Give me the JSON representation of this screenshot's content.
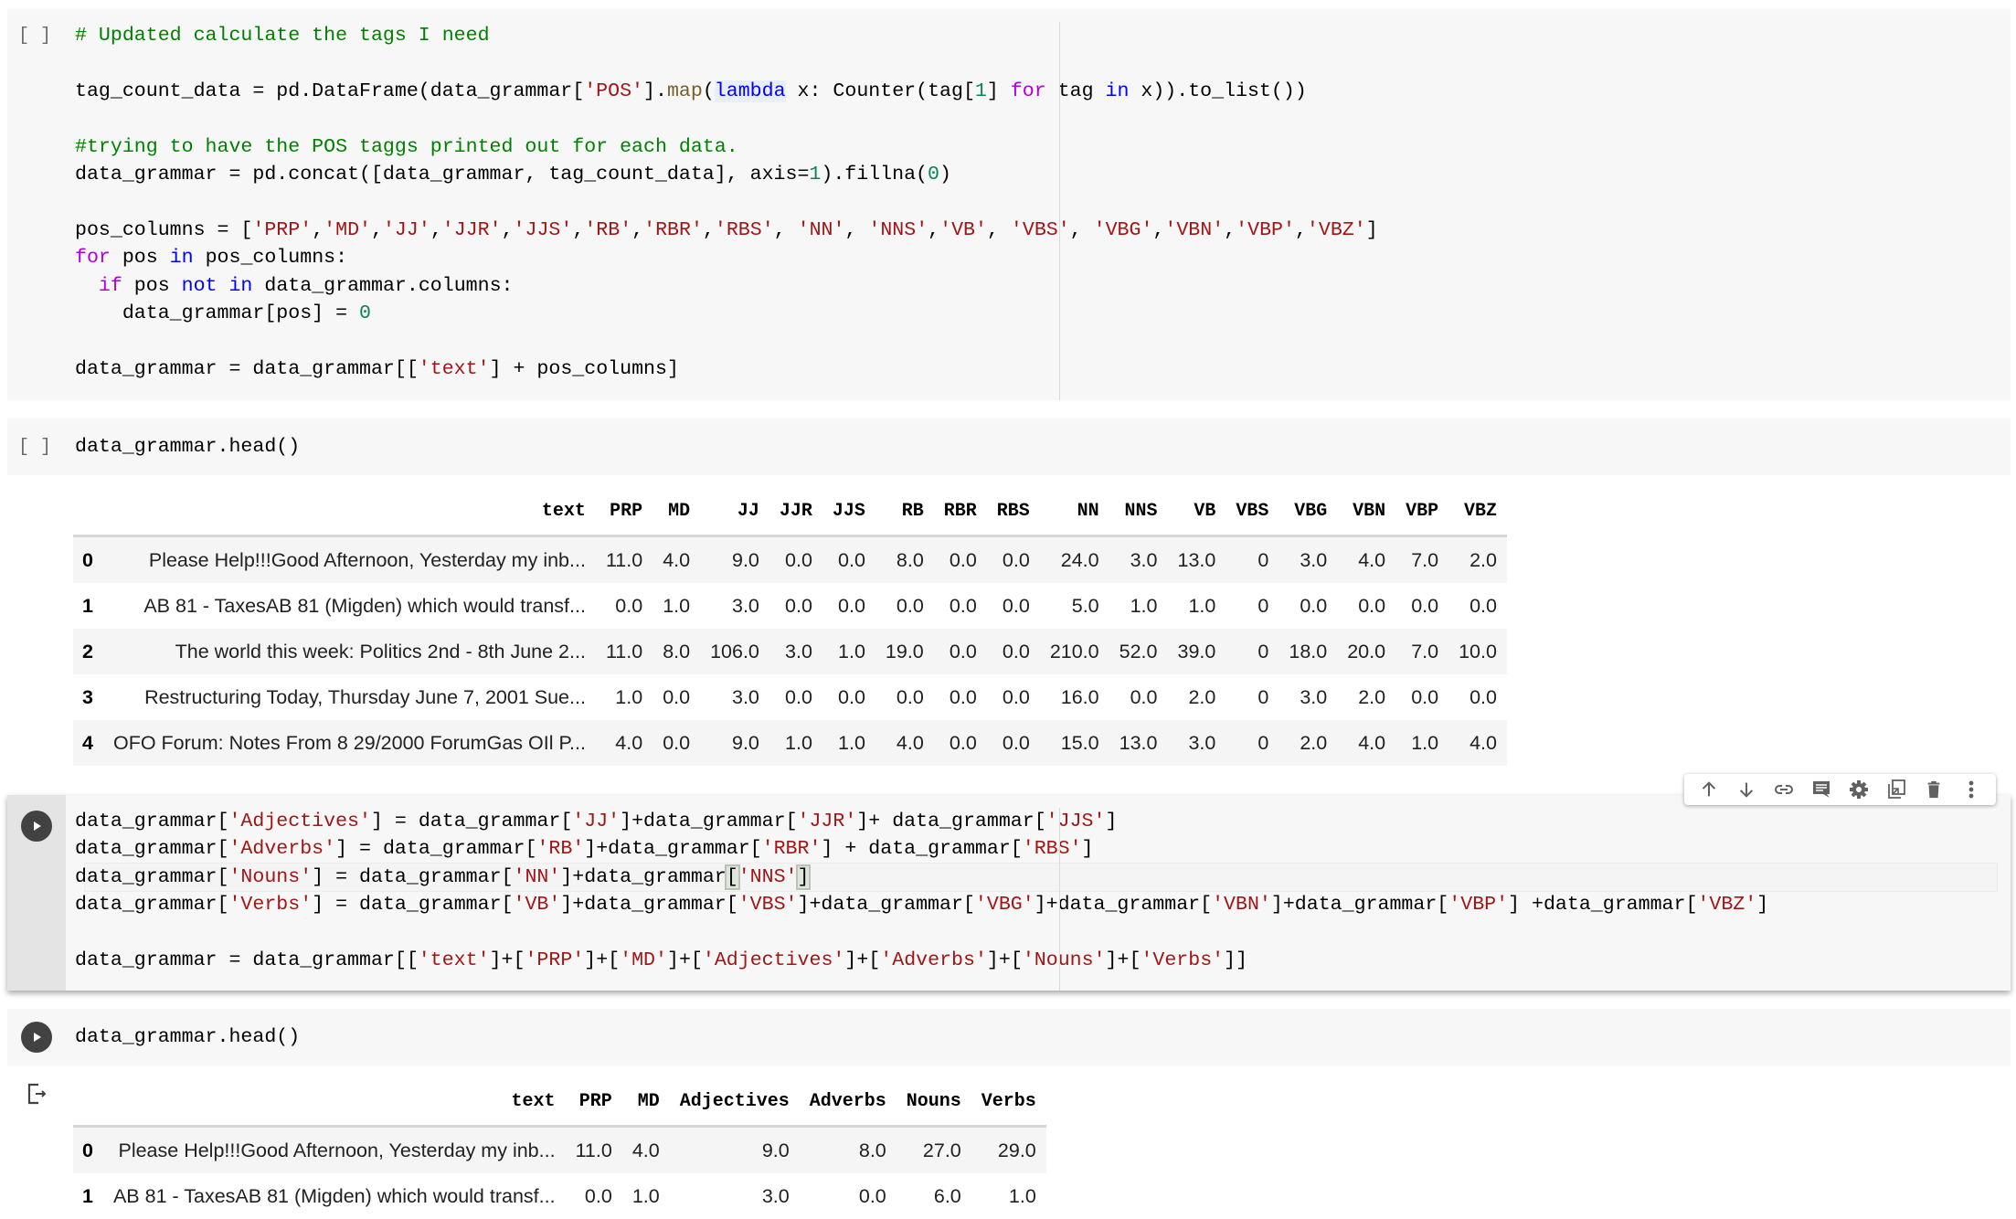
{
  "cells": [
    {
      "prompt": "[ ]",
      "lines": [
        [
          {
            "t": "# Updated calculate the tags I need",
            "c": "c-com"
          }
        ],
        [],
        [
          {
            "t": "tag_count_data = pd.DataFrame(data_grammar["
          },
          {
            "t": "'POS'",
            "c": "c-str"
          },
          {
            "t": "]."
          },
          {
            "t": "map",
            "c": "c-fn"
          },
          {
            "t": "("
          },
          {
            "t": "lambda",
            "c": "c-op hl-lambda"
          },
          {
            "t": " x: Counter(tag["
          },
          {
            "t": "1",
            "c": "c-num"
          },
          {
            "t": "] "
          },
          {
            "t": "for",
            "c": "c-kw"
          },
          {
            "t": " tag "
          },
          {
            "t": "in",
            "c": "c-op"
          },
          {
            "t": " x)).to_list())"
          }
        ],
        [],
        [
          {
            "t": "#trying to have the POS taggs printed out for each data.",
            "c": "c-com"
          }
        ],
        [
          {
            "t": "data_grammar = pd.concat([data_grammar, tag_count_data], axis="
          },
          {
            "t": "1",
            "c": "c-num"
          },
          {
            "t": ").fillna("
          },
          {
            "t": "0",
            "c": "c-num"
          },
          {
            "t": ")"
          }
        ],
        [],
        [
          {
            "t": "pos_columns = ["
          },
          {
            "t": "'PRP'",
            "c": "c-str"
          },
          {
            "t": ","
          },
          {
            "t": "'MD'",
            "c": "c-str"
          },
          {
            "t": ","
          },
          {
            "t": "'JJ'",
            "c": "c-str"
          },
          {
            "t": ","
          },
          {
            "t": "'JJR'",
            "c": "c-str"
          },
          {
            "t": ","
          },
          {
            "t": "'JJS'",
            "c": "c-str"
          },
          {
            "t": ","
          },
          {
            "t": "'RB'",
            "c": "c-str"
          },
          {
            "t": ","
          },
          {
            "t": "'RBR'",
            "c": "c-str"
          },
          {
            "t": ","
          },
          {
            "t": "'RBS'",
            "c": "c-str"
          },
          {
            "t": ", "
          },
          {
            "t": "'NN'",
            "c": "c-str"
          },
          {
            "t": ", "
          },
          {
            "t": "'NNS'",
            "c": "c-str"
          },
          {
            "t": ","
          },
          {
            "t": "'VB'",
            "c": "c-str"
          },
          {
            "t": ", "
          },
          {
            "t": "'VBS'",
            "c": "c-str"
          },
          {
            "t": ", "
          },
          {
            "t": "'VBG'",
            "c": "c-str"
          },
          {
            "t": ","
          },
          {
            "t": "'VBN'",
            "c": "c-str"
          },
          {
            "t": ","
          },
          {
            "t": "'VBP'",
            "c": "c-str"
          },
          {
            "t": ","
          },
          {
            "t": "'VBZ'",
            "c": "c-str"
          },
          {
            "t": "]"
          }
        ],
        [
          {
            "t": "for",
            "c": "c-kw"
          },
          {
            "t": " pos "
          },
          {
            "t": "in",
            "c": "c-op"
          },
          {
            "t": " pos_columns:"
          }
        ],
        [
          {
            "t": "  "
          },
          {
            "t": "if",
            "c": "c-kw"
          },
          {
            "t": " pos "
          },
          {
            "t": "not in",
            "c": "c-op"
          },
          {
            "t": " data_grammar.columns:"
          }
        ],
        [
          {
            "t": "    data_grammar[pos] = "
          },
          {
            "t": "0",
            "c": "c-num"
          }
        ],
        [],
        [
          {
            "t": "data_grammar = data_grammar[["
          },
          {
            "t": "'text'",
            "c": "c-str"
          },
          {
            "t": "] + pos_columns]"
          }
        ]
      ]
    },
    {
      "prompt": "[ ]",
      "lines": [
        [
          {
            "t": "data_grammar.head()"
          }
        ]
      ]
    },
    {
      "prompt": "",
      "lines": [
        [
          {
            "t": "data_grammar["
          },
          {
            "t": "'Adjectives'",
            "c": "c-str"
          },
          {
            "t": "] = data_grammar["
          },
          {
            "t": "'JJ'",
            "c": "c-str"
          },
          {
            "t": "]+data_grammar["
          },
          {
            "t": "'JJR'",
            "c": "c-str"
          },
          {
            "t": "]+ data_grammar["
          },
          {
            "t": "'JJS'",
            "c": "c-str"
          },
          {
            "t": "]"
          }
        ],
        [
          {
            "t": "data_grammar["
          },
          {
            "t": "'Adverbs'",
            "c": "c-str"
          },
          {
            "t": "] = data_grammar["
          },
          {
            "t": "'RB'",
            "c": "c-str"
          },
          {
            "t": "]+data_grammar["
          },
          {
            "t": "'RBR'",
            "c": "c-str"
          },
          {
            "t": "] + data_grammar["
          },
          {
            "t": "'RBS'",
            "c": "c-str"
          },
          {
            "t": "]"
          }
        ],
        [
          {
            "t": "data_grammar["
          },
          {
            "t": "'Nouns'",
            "c": "c-str"
          },
          {
            "t": "] = data_grammar["
          },
          {
            "t": "'NN'",
            "c": "c-str"
          },
          {
            "t": "]+data_grammar"
          },
          {
            "t": "[",
            "c": "hl-bracket"
          },
          {
            "t": "'NNS'",
            "c": "c-str"
          },
          {
            "t": "]",
            "c": "hl-bracket"
          }
        ],
        [
          {
            "t": "data_grammar["
          },
          {
            "t": "'Verbs'",
            "c": "c-str"
          },
          {
            "t": "] = data_grammar["
          },
          {
            "t": "'VB'",
            "c": "c-str"
          },
          {
            "t": "]+data_grammar["
          },
          {
            "t": "'VBS'",
            "c": "c-str"
          },
          {
            "t": "]+data_grammar["
          },
          {
            "t": "'VBG'",
            "c": "c-str"
          },
          {
            "t": "]+data_grammar["
          },
          {
            "t": "'VBN'",
            "c": "c-str"
          },
          {
            "t": "]+data_grammar["
          },
          {
            "t": "'VBP'",
            "c": "c-str"
          },
          {
            "t": "] +data_grammar["
          },
          {
            "t": "'VBZ'",
            "c": "c-str"
          },
          {
            "t": "]"
          }
        ],
        [],
        [
          {
            "t": "data_grammar = data_grammar[["
          },
          {
            "t": "'text'",
            "c": "c-str"
          },
          {
            "t": "]+["
          },
          {
            "t": "'PRP'",
            "c": "c-str"
          },
          {
            "t": "]+["
          },
          {
            "t": "'MD'",
            "c": "c-str"
          },
          {
            "t": "]+["
          },
          {
            "t": "'Adjectives'",
            "c": "c-str"
          },
          {
            "t": "]+["
          },
          {
            "t": "'Adverbs'",
            "c": "c-str"
          },
          {
            "t": "]+["
          },
          {
            "t": "'Nouns'",
            "c": "c-str"
          },
          {
            "t": "]+["
          },
          {
            "t": "'Verbs'",
            "c": "c-str"
          },
          {
            "t": "]]"
          }
        ]
      ]
    },
    {
      "prompt": "",
      "lines": [
        [
          {
            "t": "data_grammar.head()"
          }
        ]
      ]
    }
  ],
  "table1": {
    "columns": [
      "",
      "text",
      "PRP",
      "MD",
      "JJ",
      "JJR",
      "JJS",
      "RB",
      "RBR",
      "RBS",
      "NN",
      "NNS",
      "VB",
      "VBS",
      "VBG",
      "VBN",
      "VBP",
      "VBZ"
    ],
    "rows": [
      [
        "0",
        "Please Help!!!Good Afternoon, Yesterday my inb...",
        "11.0",
        "4.0",
        "9.0",
        "0.0",
        "0.0",
        "8.0",
        "0.0",
        "0.0",
        "24.0",
        "3.0",
        "13.0",
        "0",
        "3.0",
        "4.0",
        "7.0",
        "2.0"
      ],
      [
        "1",
        "AB 81 - TaxesAB 81 (Migden) which would transf...",
        "0.0",
        "1.0",
        "3.0",
        "0.0",
        "0.0",
        "0.0",
        "0.0",
        "0.0",
        "5.0",
        "1.0",
        "1.0",
        "0",
        "0.0",
        "0.0",
        "0.0",
        "0.0"
      ],
      [
        "2",
        "The world this week: Politics 2nd - 8th June 2...",
        "11.0",
        "8.0",
        "106.0",
        "3.0",
        "1.0",
        "19.0",
        "0.0",
        "0.0",
        "210.0",
        "52.0",
        "39.0",
        "0",
        "18.0",
        "20.0",
        "7.0",
        "10.0"
      ],
      [
        "3",
        "Restructuring Today, Thursday June 7, 2001 Sue...",
        "1.0",
        "0.0",
        "3.0",
        "0.0",
        "0.0",
        "0.0",
        "0.0",
        "0.0",
        "16.0",
        "0.0",
        "2.0",
        "0",
        "3.0",
        "2.0",
        "0.0",
        "0.0"
      ],
      [
        "4",
        "OFO Forum: Notes From 8 29/2000 ForumGas OIl P...",
        "4.0",
        "0.0",
        "9.0",
        "1.0",
        "1.0",
        "4.0",
        "0.0",
        "0.0",
        "15.0",
        "13.0",
        "3.0",
        "0",
        "2.0",
        "4.0",
        "1.0",
        "4.0"
      ]
    ]
  },
  "table2": {
    "columns": [
      "",
      "text",
      "PRP",
      "MD",
      "Adjectives",
      "Adverbs",
      "Nouns",
      "Verbs"
    ],
    "rows": [
      [
        "0",
        "Please Help!!!Good Afternoon, Yesterday my inb...",
        "11.0",
        "4.0",
        "9.0",
        "8.0",
        "27.0",
        "29.0"
      ],
      [
        "1",
        "AB 81 - TaxesAB 81 (Migden) which would transf...",
        "0.0",
        "1.0",
        "3.0",
        "0.0",
        "6.0",
        "1.0"
      ]
    ]
  },
  "toolbar": {
    "items": [
      "move-cell-up",
      "move-cell-down",
      "copy-link",
      "add-comment",
      "open-settings",
      "mirror-cell-in-tab",
      "delete-cell",
      "more-actions"
    ]
  },
  "colors": {
    "cell_bg": "#f7f7f7",
    "comment": "#008000",
    "string": "#a31515",
    "number": "#098658",
    "keyword": "#af00db",
    "operator": "#0000ff",
    "function": "#795e26",
    "run_button": "#424242"
  }
}
